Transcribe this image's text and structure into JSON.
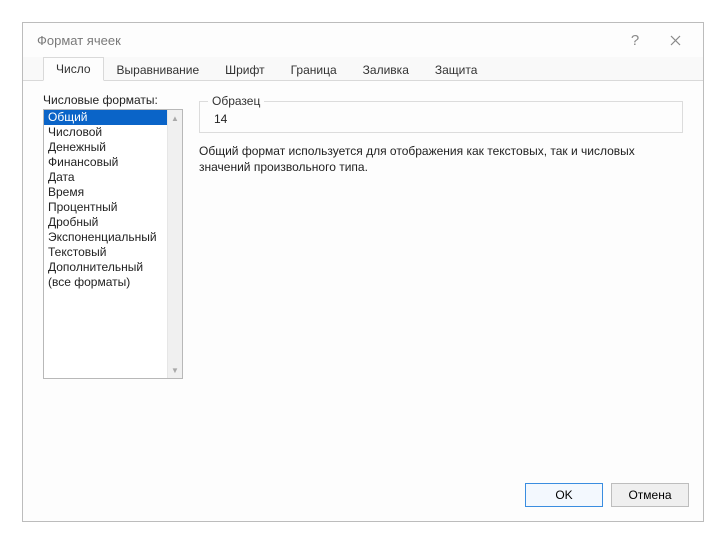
{
  "dialog": {
    "title": "Формат ячеек"
  },
  "tabs": {
    "items": [
      {
        "label": "Число"
      },
      {
        "label": "Выравнивание"
      },
      {
        "label": "Шрифт"
      },
      {
        "label": "Граница"
      },
      {
        "label": "Заливка"
      },
      {
        "label": "Защита"
      }
    ]
  },
  "formats": {
    "label": "Числовые форматы:",
    "items": [
      "Общий",
      "Числовой",
      "Денежный",
      "Финансовый",
      "Дата",
      "Время",
      "Процентный",
      "Дробный",
      "Экспоненциальный",
      "Текстовый",
      "Дополнительный",
      "(все форматы)"
    ]
  },
  "sample": {
    "label": "Образец",
    "value": "14"
  },
  "description": "Общий формат используется для отображения как текстовых, так и числовых значений произвольного типа.",
  "buttons": {
    "ok": "OK",
    "cancel": "Отмена"
  }
}
